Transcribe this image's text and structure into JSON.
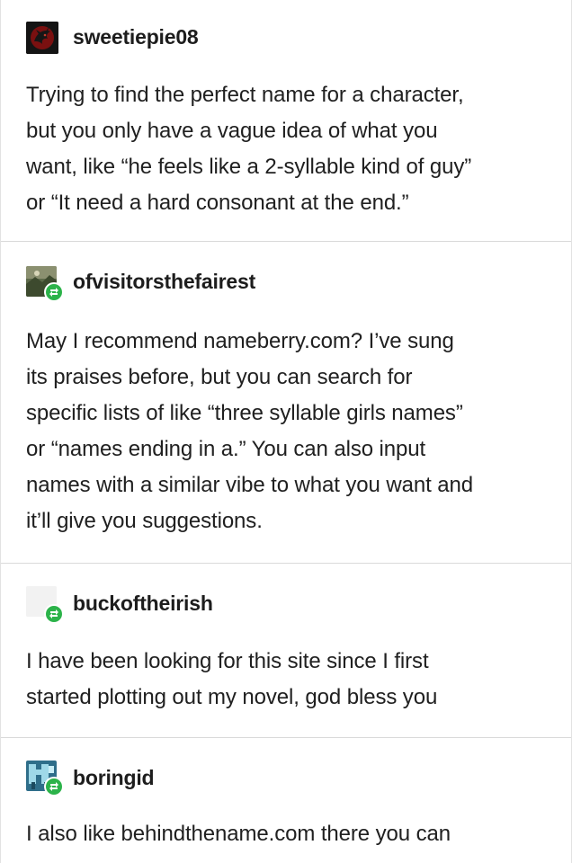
{
  "posts": [
    {
      "username": "sweetiepie08",
      "avatar_icon": "dragon-sigil-icon",
      "body": "Trying to find the perfect name for a character,\nbut you only have a vague idea of what you\nwant, like “he feels like a 2-syllable kind of guy”\nor “It need a hard consonant at the end.”"
    },
    {
      "username": "ofvisitorsthefairest",
      "avatar_icon": "landscape-avatar-icon",
      "reblog_icon": "reblog-icon",
      "body": "May I recommend nameberry.com? I’ve sung\nits praises before, but you can search for\nspecific lists of like “three syllable girls names”\nor “names ending in a.” You can also input\nnames with a similar vibe to what you want and\nit’ll give you suggestions."
    },
    {
      "username": "buckoftheirish",
      "avatar_icon": "blank-avatar-icon",
      "reblog_icon": "reblog-icon",
      "body": "I have been looking for this site since I first\nstarted plotting out my novel, god bless you"
    },
    {
      "username": "boringid",
      "avatar_icon": "pixel-art-avatar-icon",
      "reblog_icon": "reblog-icon",
      "body": "I also like behindthename.com there you can"
    }
  ],
  "colors": {
    "reblog_green": "#2cb34a",
    "text": "#202020",
    "divider": "#d9d9d9"
  }
}
